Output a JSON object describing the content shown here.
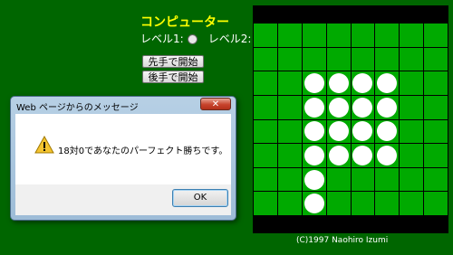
{
  "game": {
    "title": "コンピューター",
    "level1_label": "レベル1:",
    "level2_label": "レベル2:",
    "level_selected": 2,
    "first_move_button": "先手で開始",
    "second_move_button": "後手で開始",
    "copyright": "(C)1997  Naohiro Izumi"
  },
  "board": {
    "size": 8,
    "white_discs": [
      [
        2,
        2
      ],
      [
        2,
        3
      ],
      [
        2,
        4
      ],
      [
        2,
        5
      ],
      [
        3,
        2
      ],
      [
        3,
        3
      ],
      [
        3,
        4
      ],
      [
        3,
        5
      ],
      [
        4,
        2
      ],
      [
        4,
        3
      ],
      [
        4,
        4
      ],
      [
        4,
        5
      ],
      [
        5,
        2
      ],
      [
        5,
        3
      ],
      [
        5,
        4
      ],
      [
        5,
        5
      ],
      [
        6,
        2
      ],
      [
        7,
        2
      ]
    ]
  },
  "dialog": {
    "title": "Web ページからのメッセージ",
    "message": "18対0であなたのパーフェクト勝ちです。",
    "ok_label": "OK",
    "close_label": "✕",
    "icon": "warning-icon"
  }
}
